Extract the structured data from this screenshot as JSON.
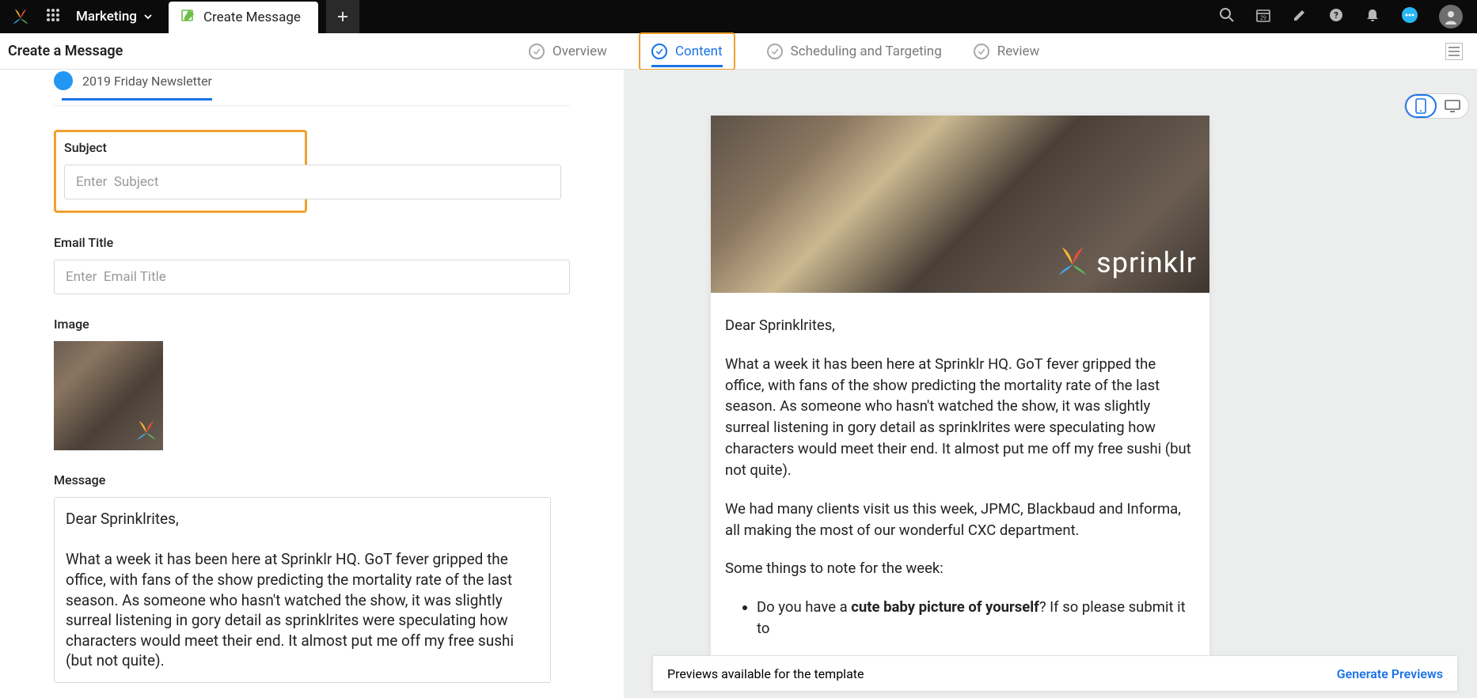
{
  "topbar": {
    "workspace": "Marketing",
    "active_tab_label": "Create Message"
  },
  "subheader": {
    "title": "Create a Message",
    "steps": {
      "overview": "Overview",
      "content": "Content",
      "scheduling": "Scheduling and Targeting",
      "review": "Review"
    }
  },
  "left": {
    "template_name": "2019 Friday Newsletter",
    "subject_label": "Subject",
    "subject_placeholder": "Enter  Subject",
    "email_title_label": "Email Title",
    "email_title_placeholder": "Enter  Email Title",
    "image_label": "Image",
    "message_label": "Message",
    "message_value": "Dear Sprinklrites,\n\nWhat a week it has been here at Sprinklr HQ. GoT fever gripped the office, with fans of the show predicting the mortality rate of the last season. As someone who hasn't watched the show, it was slightly surreal listening in gory detail as sprinklrites were speculating how characters would meet their end. It almost put me off my free sushi (but not quite)."
  },
  "preview": {
    "brand_text": "sprinklr",
    "greeting": "Dear Sprinklrites,",
    "para1": "What a week it has been here at Sprinklr HQ. GoT fever gripped the office, with fans of the show predicting the mortality rate of the last season. As someone who hasn't watched the show, it was slightly surreal listening in gory detail as sprinklrites were speculating how characters would meet their end. It almost put me off my free sushi (but not quite).",
    "para2": "We had many clients visit us this week, JPMC, Blackbaud and Informa, all making the most of our wonderful CXC department.",
    "para3": "Some things to note for the week:",
    "bullet1_pre": "Do you have a ",
    "bullet1_bold": "cute baby picture of yourself",
    "bullet1_post": "? If so please submit it to",
    "footer_text": "Previews available for the template",
    "footer_action": "Generate Previews"
  }
}
